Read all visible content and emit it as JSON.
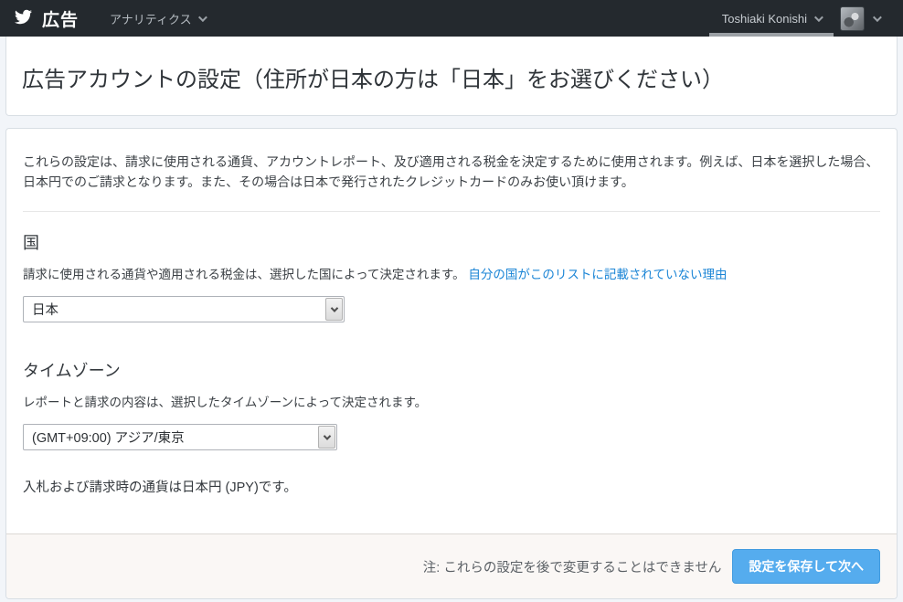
{
  "navbar": {
    "brand_label": "広告",
    "analytics_label": "アナリティクス",
    "user_name": "Toshiaki Konishi"
  },
  "page": {
    "title": "広告アカウントの設定（住所が日本の方は「日本」をお選びください）"
  },
  "settings_card": {
    "intro": "これらの設定は、請求に使用される通貨、アカウントレポート、及び適用される税金を決定するために使用されます。例えば、日本を選択した場合、日本円でのご請求となります。また、その場合は日本で発行されたクレジットカードのみお使い頂けます。",
    "country": {
      "heading": "国",
      "description": "請求に使用される通貨や適用される税金は、選択した国によって決定されます。",
      "help_link": "自分の国がこのリストに記載されていない理由",
      "selected_value": "日本"
    },
    "timezone": {
      "heading": "タイムゾーン",
      "description": "レポートと請求の内容は、選択したタイムゾーンによって決定されます。",
      "selected_value": "(GMT+09:00) アジア/東京"
    },
    "currency_note": "入札および請求時の通貨は日本円 (JPY)です。",
    "footer": {
      "note": "注: これらの設定を後で変更することはできません",
      "save_button_label": "設定を保存して次へ"
    }
  },
  "colors": {
    "navbar_bg": "#24292e",
    "accent_blue": "#55acee",
    "link_blue": "#1b85d6",
    "page_bg": "#f2f5f9",
    "footer_bg": "#faf7f5"
  },
  "icons": {
    "brand": "twitter-bird-icon",
    "dropdowns": "chevron-down-icon"
  }
}
